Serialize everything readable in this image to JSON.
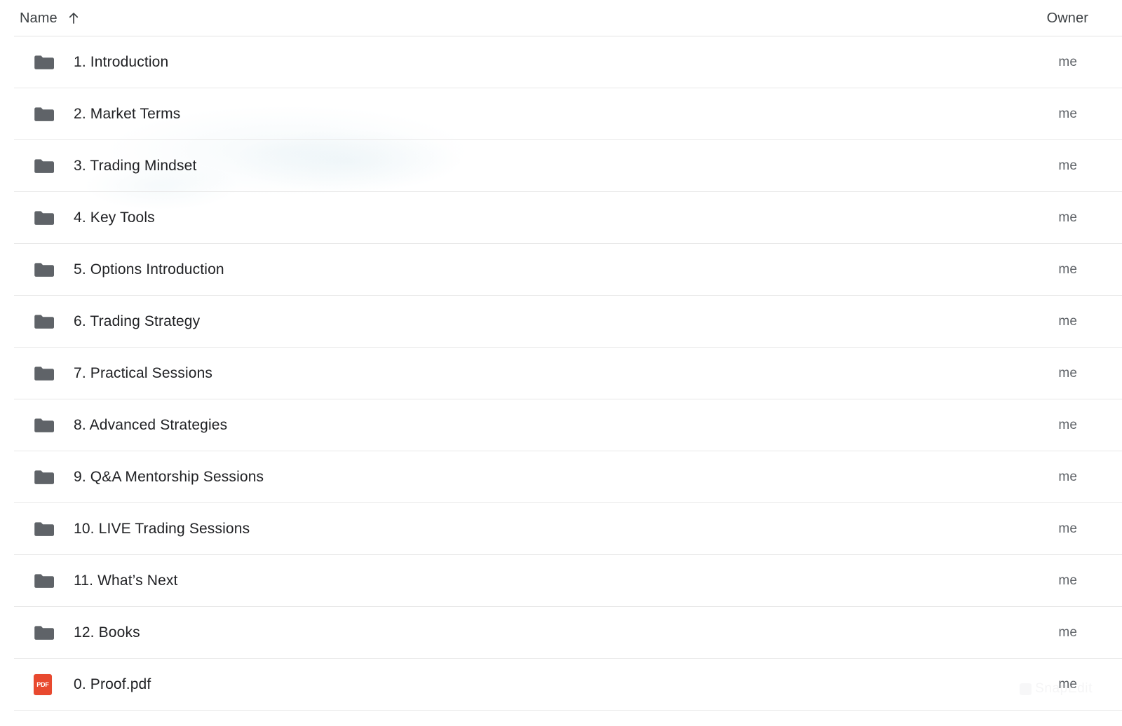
{
  "header": {
    "name_label": "Name",
    "sort_icon": "arrow-up-icon",
    "sort_direction": "ascending",
    "owner_label": "Owner"
  },
  "watermark": {
    "text": "SnapEdit"
  },
  "rows": [
    {
      "icon": "folder-icon",
      "name": "1. Introduction",
      "owner": "me"
    },
    {
      "icon": "folder-icon",
      "name": "2. Market Terms",
      "owner": "me"
    },
    {
      "icon": "folder-icon",
      "name": "3. Trading Mindset",
      "owner": "me"
    },
    {
      "icon": "folder-icon",
      "name": "4. Key Tools",
      "owner": "me"
    },
    {
      "icon": "folder-icon",
      "name": "5. Options Introduction",
      "owner": "me"
    },
    {
      "icon": "folder-icon",
      "name": "6. Trading Strategy",
      "owner": "me"
    },
    {
      "icon": "folder-icon",
      "name": "7. Practical Sessions",
      "owner": "me"
    },
    {
      "icon": "folder-icon",
      "name": "8. Advanced Strategies",
      "owner": "me"
    },
    {
      "icon": "folder-icon",
      "name": "9. Q&A Mentorship Sessions",
      "owner": "me"
    },
    {
      "icon": "folder-icon",
      "name": "10. LIVE Trading Sessions",
      "owner": "me"
    },
    {
      "icon": "folder-icon",
      "name": "11. What’s Next",
      "owner": "me"
    },
    {
      "icon": "folder-icon",
      "name": "12. Books",
      "owner": "me"
    },
    {
      "icon": "pdf-icon",
      "name": "0. Proof.pdf",
      "owner": "me",
      "icon_text": "PDF"
    }
  ],
  "colors": {
    "folder": "#5f6368",
    "pdf_badge": "#e8492f",
    "text_primary": "#202124",
    "text_secondary": "#5f6368",
    "divider": "#e8e8e8",
    "background": "#ffffff"
  }
}
